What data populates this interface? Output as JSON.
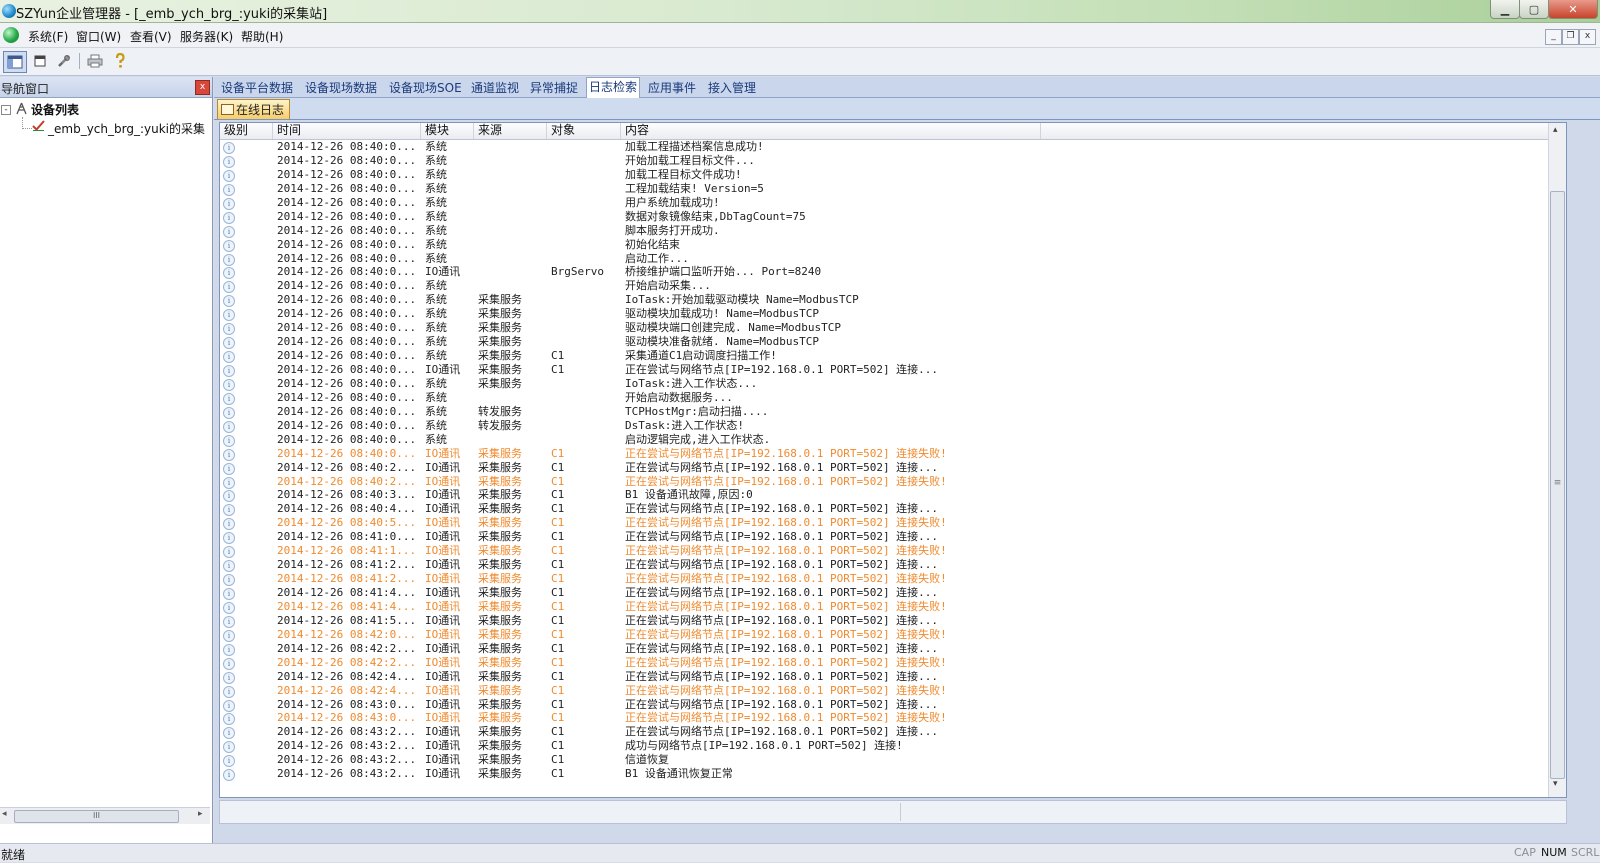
{
  "window": {
    "title": "SZYun企业管理器 - [_emb_ych_brg_:yuki的采集站]",
    "minimize_glyph": "▁",
    "maximize_glyph": "▢",
    "close_glyph": "✕"
  },
  "menu": {
    "items": [
      "系统(F)",
      "窗口(W)",
      "查看(V)",
      "服务器(K)",
      "帮助(H)"
    ],
    "mdi_min": "_",
    "mdi_restore": "❐",
    "mdi_close": "x"
  },
  "toolbar": {
    "icons": [
      "layout-icon",
      "window-icon",
      "tools-icon",
      "print-icon",
      "help-icon"
    ]
  },
  "nav": {
    "title": "导航窗口",
    "close_glyph": "x",
    "tree_expander": "-",
    "root_label": "设备列表",
    "child_label": "_emb_ych_brg_:yuki的采集",
    "hscroll_left": "◂",
    "hscroll_right": "▸",
    "hscroll_grip": "III"
  },
  "tabs": {
    "items": [
      "设备平台数据",
      "设备现场数据",
      "设备现场SOE",
      "通道监视",
      "异常捕捉",
      "日志检索",
      "应用事件",
      "接入管理"
    ],
    "active_index": 5,
    "subtab_label": "在线日志"
  },
  "log": {
    "columns": [
      "级别",
      "时间",
      "模块",
      "来源",
      "对象",
      "内容"
    ],
    "info_glyph": "i",
    "rows": [
      {
        "level": "info",
        "time": "2014-12-26 08:40:0...",
        "module": "系统",
        "source": "",
        "object": "",
        "content": "加载工程描述档案信息成功!"
      },
      {
        "level": "info",
        "time": "2014-12-26 08:40:0...",
        "module": "系统",
        "source": "",
        "object": "",
        "content": "开始加载工程目标文件..."
      },
      {
        "level": "info",
        "time": "2014-12-26 08:40:0...",
        "module": "系统",
        "source": "",
        "object": "",
        "content": "加载工程目标文件成功!"
      },
      {
        "level": "info",
        "time": "2014-12-26 08:40:0...",
        "module": "系统",
        "source": "",
        "object": "",
        "content": "工程加载结束! Version=5"
      },
      {
        "level": "info",
        "time": "2014-12-26 08:40:0...",
        "module": "系统",
        "source": "",
        "object": "",
        "content": "用户系统加载成功!"
      },
      {
        "level": "info",
        "time": "2014-12-26 08:40:0...",
        "module": "系统",
        "source": "",
        "object": "",
        "content": "数据对象镜像结束,DbTagCount=75"
      },
      {
        "level": "info",
        "time": "2014-12-26 08:40:0...",
        "module": "系统",
        "source": "",
        "object": "",
        "content": "脚本服务打开成功."
      },
      {
        "level": "info",
        "time": "2014-12-26 08:40:0...",
        "module": "系统",
        "source": "",
        "object": "",
        "content": "初始化结束"
      },
      {
        "level": "info",
        "time": "2014-12-26 08:40:0...",
        "module": "系统",
        "source": "",
        "object": "",
        "content": "启动工作..."
      },
      {
        "level": "info",
        "time": "2014-12-26 08:40:0...",
        "module": "IO通讯",
        "source": "",
        "object": "BrgServo",
        "content": "桥接维护端口监听开始... Port=8240"
      },
      {
        "level": "info",
        "time": "2014-12-26 08:40:0...",
        "module": "系统",
        "source": "",
        "object": "",
        "content": "开始启动采集..."
      },
      {
        "level": "info",
        "time": "2014-12-26 08:40:0...",
        "module": "系统",
        "source": "采集服务",
        "object": "",
        "content": "IoTask:开始加载驱动模块 Name=ModbusTCP"
      },
      {
        "level": "info",
        "time": "2014-12-26 08:40:0...",
        "module": "系统",
        "source": "采集服务",
        "object": "",
        "content": "驱动模块加载成功! Name=ModbusTCP"
      },
      {
        "level": "info",
        "time": "2014-12-26 08:40:0...",
        "module": "系统",
        "source": "采集服务",
        "object": "",
        "content": "驱动模块端口创建完成. Name=ModbusTCP"
      },
      {
        "level": "info",
        "time": "2014-12-26 08:40:0...",
        "module": "系统",
        "source": "采集服务",
        "object": "",
        "content": "驱动模块准备就绪. Name=ModbusTCP"
      },
      {
        "level": "info",
        "time": "2014-12-26 08:40:0...",
        "module": "系统",
        "source": "采集服务",
        "object": "C1",
        "content": "采集通道C1启动调度扫描工作!"
      },
      {
        "level": "info",
        "time": "2014-12-26 08:40:0...",
        "module": "IO通讯",
        "source": "采集服务",
        "object": "C1",
        "content": "正在尝试与网络节点[IP=192.168.0.1 PORT=502] 连接..."
      },
      {
        "level": "info",
        "time": "2014-12-26 08:40:0...",
        "module": "系统",
        "source": "采集服务",
        "object": "",
        "content": "IoTask:进入工作状态..."
      },
      {
        "level": "info",
        "time": "2014-12-26 08:40:0...",
        "module": "系统",
        "source": "",
        "object": "",
        "content": "开始启动数据服务..."
      },
      {
        "level": "info",
        "time": "2014-12-26 08:40:0...",
        "module": "系统",
        "source": "转发服务",
        "object": "",
        "content": "TCPHostMgr:启动扫描...."
      },
      {
        "level": "info",
        "time": "2014-12-26 08:40:0...",
        "module": "系统",
        "source": "转发服务",
        "object": "",
        "content": "DsTask:进入工作状态!"
      },
      {
        "level": "info",
        "time": "2014-12-26 08:40:0...",
        "module": "系统",
        "source": "",
        "object": "",
        "content": "启动逻辑完成,进入工作状态."
      },
      {
        "level": "warn",
        "time": "2014-12-26 08:40:0...",
        "module": "IO通讯",
        "source": "采集服务",
        "object": "C1",
        "content": "正在尝试与网络节点[IP=192.168.0.1 PORT=502] 连接失败!"
      },
      {
        "level": "info",
        "time": "2014-12-26 08:40:2...",
        "module": "IO通讯",
        "source": "采集服务",
        "object": "C1",
        "content": "正在尝试与网络节点[IP=192.168.0.1 PORT=502] 连接..."
      },
      {
        "level": "warn",
        "time": "2014-12-26 08:40:2...",
        "module": "IO通讯",
        "source": "采集服务",
        "object": "C1",
        "content": "正在尝试与网络节点[IP=192.168.0.1 PORT=502] 连接失败!"
      },
      {
        "level": "info",
        "time": "2014-12-26 08:40:3...",
        "module": "IO通讯",
        "source": "采集服务",
        "object": "C1",
        "content": "B1 设备通讯故障,原因:0"
      },
      {
        "level": "info",
        "time": "2014-12-26 08:40:4...",
        "module": "IO通讯",
        "source": "采集服务",
        "object": "C1",
        "content": "正在尝试与网络节点[IP=192.168.0.1 PORT=502] 连接..."
      },
      {
        "level": "warn",
        "time": "2014-12-26 08:40:5...",
        "module": "IO通讯",
        "source": "采集服务",
        "object": "C1",
        "content": "正在尝试与网络节点[IP=192.168.0.1 PORT=502] 连接失败!"
      },
      {
        "level": "info",
        "time": "2014-12-26 08:41:0...",
        "module": "IO通讯",
        "source": "采集服务",
        "object": "C1",
        "content": "正在尝试与网络节点[IP=192.168.0.1 PORT=502] 连接..."
      },
      {
        "level": "warn",
        "time": "2014-12-26 08:41:1...",
        "module": "IO通讯",
        "source": "采集服务",
        "object": "C1",
        "content": "正在尝试与网络节点[IP=192.168.0.1 PORT=502] 连接失败!"
      },
      {
        "level": "info",
        "time": "2014-12-26 08:41:2...",
        "module": "IO通讯",
        "source": "采集服务",
        "object": "C1",
        "content": "正在尝试与网络节点[IP=192.168.0.1 PORT=502] 连接..."
      },
      {
        "level": "warn",
        "time": "2014-12-26 08:41:2...",
        "module": "IO通讯",
        "source": "采集服务",
        "object": "C1",
        "content": "正在尝试与网络节点[IP=192.168.0.1 PORT=502] 连接失败!"
      },
      {
        "level": "info",
        "time": "2014-12-26 08:41:4...",
        "module": "IO通讯",
        "source": "采集服务",
        "object": "C1",
        "content": "正在尝试与网络节点[IP=192.168.0.1 PORT=502] 连接..."
      },
      {
        "level": "warn",
        "time": "2014-12-26 08:41:4...",
        "module": "IO通讯",
        "source": "采集服务",
        "object": "C1",
        "content": "正在尝试与网络节点[IP=192.168.0.1 PORT=502] 连接失败!"
      },
      {
        "level": "info",
        "time": "2014-12-26 08:41:5...",
        "module": "IO通讯",
        "source": "采集服务",
        "object": "C1",
        "content": "正在尝试与网络节点[IP=192.168.0.1 PORT=502] 连接..."
      },
      {
        "level": "warn",
        "time": "2014-12-26 08:42:0...",
        "module": "IO通讯",
        "source": "采集服务",
        "object": "C1",
        "content": "正在尝试与网络节点[IP=192.168.0.1 PORT=502] 连接失败!"
      },
      {
        "level": "info",
        "time": "2014-12-26 08:42:2...",
        "module": "IO通讯",
        "source": "采集服务",
        "object": "C1",
        "content": "正在尝试与网络节点[IP=192.168.0.1 PORT=502] 连接..."
      },
      {
        "level": "warn",
        "time": "2014-12-26 08:42:2...",
        "module": "IO通讯",
        "source": "采集服务",
        "object": "C1",
        "content": "正在尝试与网络节点[IP=192.168.0.1 PORT=502] 连接失败!"
      },
      {
        "level": "info",
        "time": "2014-12-26 08:42:4...",
        "module": "IO通讯",
        "source": "采集服务",
        "object": "C1",
        "content": "正在尝试与网络节点[IP=192.168.0.1 PORT=502] 连接..."
      },
      {
        "level": "warn",
        "time": "2014-12-26 08:42:4...",
        "module": "IO通讯",
        "source": "采集服务",
        "object": "C1",
        "content": "正在尝试与网络节点[IP=192.168.0.1 PORT=502] 连接失败!"
      },
      {
        "level": "info",
        "time": "2014-12-26 08:43:0...",
        "module": "IO通讯",
        "source": "采集服务",
        "object": "C1",
        "content": "正在尝试与网络节点[IP=192.168.0.1 PORT=502] 连接..."
      },
      {
        "level": "warn",
        "time": "2014-12-26 08:43:0...",
        "module": "IO通讯",
        "source": "采集服务",
        "object": "C1",
        "content": "正在尝试与网络节点[IP=192.168.0.1 PORT=502] 连接失败!"
      },
      {
        "level": "info",
        "time": "2014-12-26 08:43:2...",
        "module": "IO通讯",
        "source": "采集服务",
        "object": "C1",
        "content": "正在尝试与网络节点[IP=192.168.0.1 PORT=502] 连接..."
      },
      {
        "level": "info",
        "time": "2014-12-26 08:43:2...",
        "module": "IO通讯",
        "source": "采集服务",
        "object": "C1",
        "content": "成功与网络节点[IP=192.168.0.1 PORT=502] 连接!"
      },
      {
        "level": "info",
        "time": "2014-12-26 08:43:2...",
        "module": "IO通讯",
        "source": "采集服务",
        "object": "C1",
        "content": "信道恢复"
      },
      {
        "level": "info",
        "time": "2014-12-26 08:43:2...",
        "module": "IO通讯",
        "source": "采集服务",
        "object": "C1",
        "content": "B1 设备通讯恢复正常"
      }
    ],
    "colors": {
      "info": "#222222",
      "warn": "#f08a2e"
    },
    "vscroll_up": "▴",
    "vscroll_down": "▾",
    "vscroll_grip": "≡"
  },
  "status": {
    "text": "就绪",
    "indicators": [
      {
        "label": "CAP",
        "active": false
      },
      {
        "label": "NUM",
        "active": true
      },
      {
        "label": "SCRL",
        "active": false
      }
    ]
  }
}
